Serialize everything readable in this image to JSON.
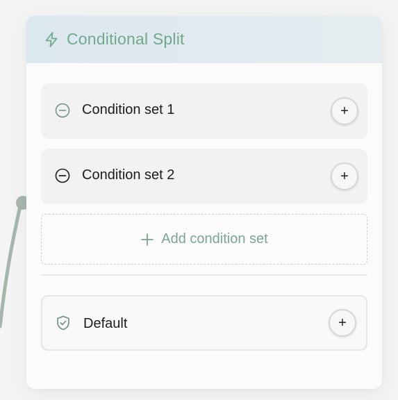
{
  "node": {
    "title": "Conditional Split",
    "icon": "lightning-bolt-icon",
    "condition_sets": [
      {
        "label": "Condition set 1",
        "icon": "minus-circle-icon",
        "add_button_label": "+"
      },
      {
        "label": "Condition set 2",
        "icon": "minus-circle-icon",
        "add_button_label": "+"
      }
    ],
    "add_condition_set_label": "Add condition set",
    "default_branch": {
      "label": "Default",
      "icon": "shield-check-icon",
      "add_button_label": "+"
    }
  },
  "colors": {
    "accent": "#72a88c",
    "header_bg": "#dce8f0",
    "connector": "#a7b6ad"
  }
}
